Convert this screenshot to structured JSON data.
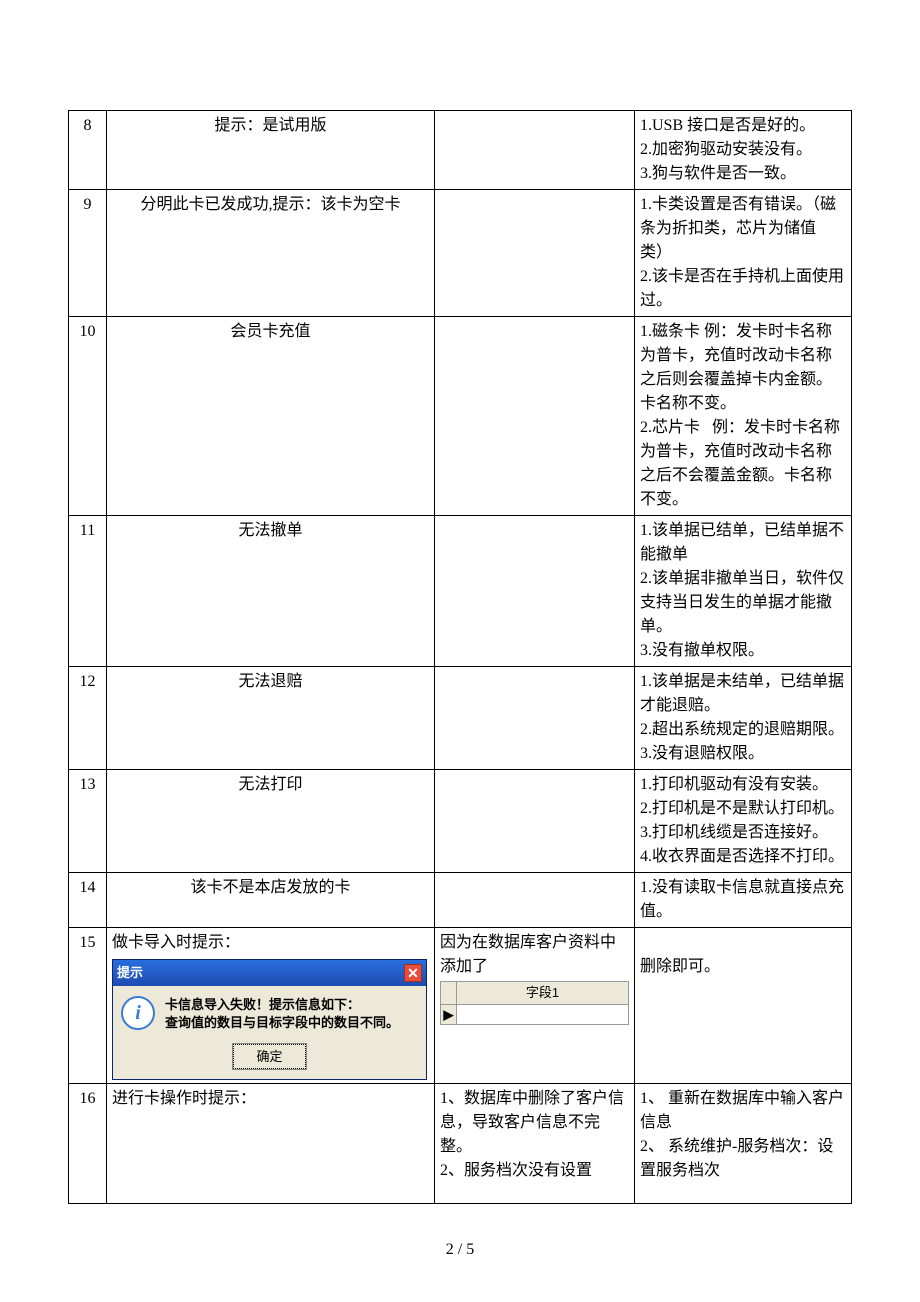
{
  "page_number": "2 / 5",
  "row15_dialog": {
    "title": "提示",
    "msg_line1": "卡信息导入失败！提示信息如下：",
    "msg_line2": "查询值的数目与目标字段中的数目不同。",
    "ok": "确定",
    "icon_glyph": "i",
    "close_glyph": "✕"
  },
  "row15_db": {
    "column_label": "字段1",
    "row_marker": "▶"
  },
  "rows": [
    {
      "n": "8",
      "a": "提示：是试用版",
      "b": "",
      "c": "1.USB 接口是否是好的。\n2.加密狗驱动安装没有。\n3.狗与软件是否一致。"
    },
    {
      "n": "9",
      "a": "分明此卡已发成功,提示：该卡为空卡",
      "b": "",
      "c": "1.卡类设置是否有错误。（磁条为折扣类，芯片为储值类）\n2.该卡是否在手持机上面使用过。"
    },
    {
      "n": "10",
      "a": "会员卡充值",
      "b": "",
      "c": "1.磁条卡 例：发卡时卡名称为普卡，充值时改动卡名称之后则会覆盖掉卡内金额。卡名称不变。\n2.芯片卡   例：发卡时卡名称为普卡，充值时改动卡名称之后不会覆盖金额。卡名称不变。"
    },
    {
      "n": "11",
      "a": "无法撤单",
      "b": "",
      "c": "1.该单据已结单，已结单据不能撤单\n2.该单据非撤单当日，软件仅支持当日发生的单据才能撤单。\n3.没有撤单权限。"
    },
    {
      "n": "12",
      "a": "无法退赔",
      "b": "",
      "c": "1.该单据是未结单，已结单据才能退赔。\n2.超出系统规定的退赔期限。\n3.没有退赔权限。"
    },
    {
      "n": "13",
      "a": "无法打印",
      "b": "",
      "c": "1.打印机驱动有没有安装。\n2.打印机是不是默认打印机。\n3.打印机线缆是否连接好。\n4.收衣界面是否选择不打印。"
    },
    {
      "n": "14",
      "a": "该卡不是本店发放的卡",
      "b": "",
      "c": "1.没有读取卡信息就直接点充值。"
    },
    {
      "n": "15",
      "a_intro": "做卡导入时提示：",
      "b_intro": "因为在数据库客户资料中添加了",
      "c": "删除即可。"
    },
    {
      "n": "16",
      "a": "进行卡操作时提示：",
      "b": "1、数据库中删除了客户信息，导致客户信息不完整。\n2、服务档次没有设置",
      "c": "1、 重新在数据库中输入客户信息\n2、 系统维护-服务档次：设置服务档次"
    }
  ]
}
